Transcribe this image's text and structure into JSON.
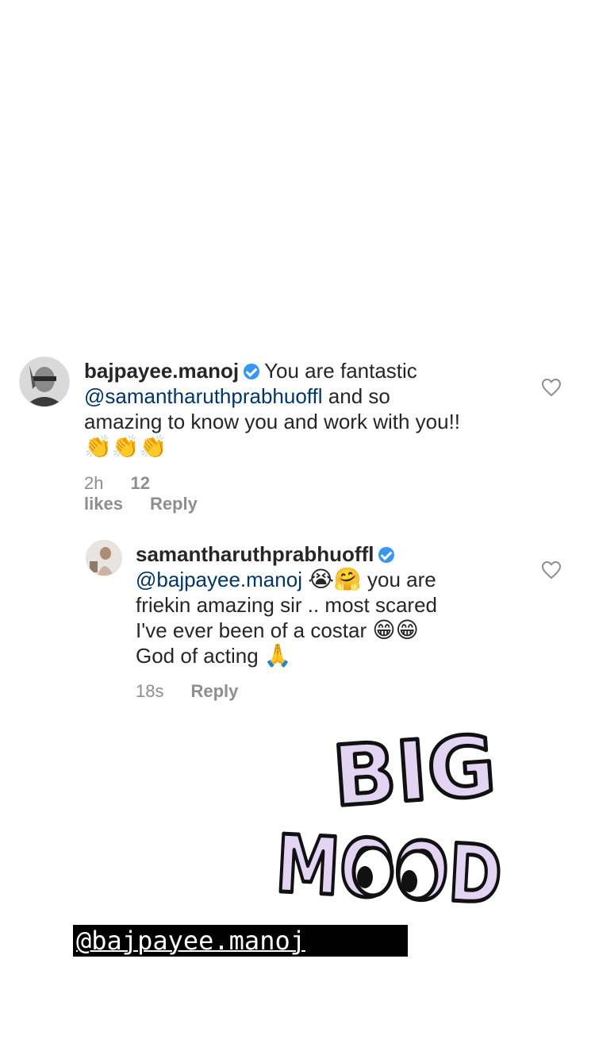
{
  "comments": [
    {
      "username": "bajpayee.manoj",
      "line1_text": "You are fantastic",
      "mention": "@samantharuthprabhuoffl",
      "line2_text": " and so",
      "line3_text": "amazing to know you and work with you!!",
      "emojis": "👏👏👏",
      "time": "2h",
      "likes": "12 likes",
      "reply": "Reply",
      "avatar_icon": "profile-photo-man",
      "heart_icon": "heart-outline-icon"
    },
    {
      "username": "samantharuthprabhuoffl",
      "mention": "@bajpayee.manoj",
      "emojis_a": "😭🤗",
      "text_a": " you are",
      "line2_text": "friekin amazing sir .. most scared",
      "line3_text": "I've ever been of a costar",
      "emojis_b": "😁😁",
      "line4_text": "God of acting",
      "emojis_c": "🙏",
      "time": "18s",
      "reply": "Reply",
      "avatar_icon": "profile-photo-woman",
      "heart_icon": "heart-outline-icon"
    }
  ],
  "sticker": {
    "word1": "BIG",
    "word2": "MOOD"
  },
  "tag": {
    "text": "@bajpayee.manoj"
  },
  "colors": {
    "verified": "#3897f0",
    "mention": "#003569",
    "meta": "#8e8e8e",
    "sticker_fill": "#e4d4f4",
    "tag_bg": "#000000"
  }
}
